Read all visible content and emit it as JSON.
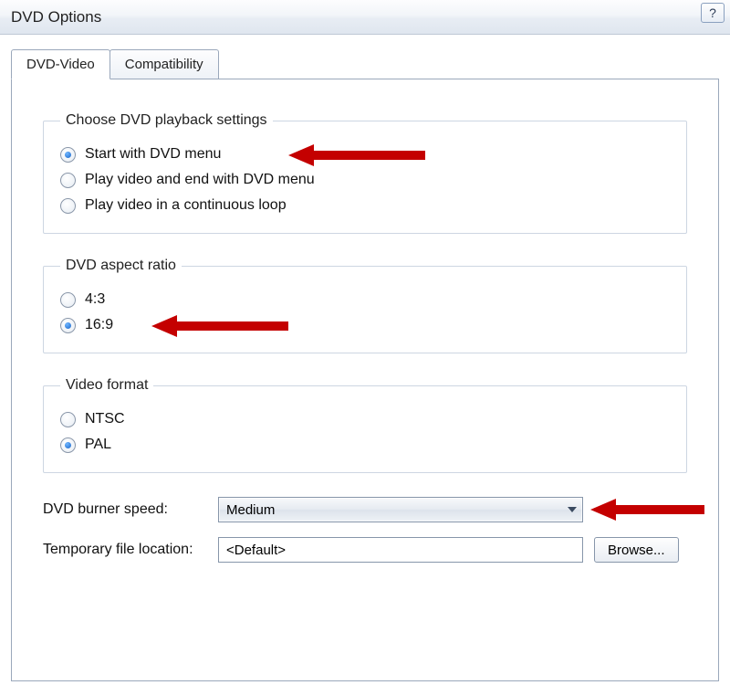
{
  "window": {
    "title": "DVD Options"
  },
  "tabs": {
    "t0": "DVD-Video",
    "t1": "Compatibility"
  },
  "playback": {
    "legend": "Choose DVD playback settings",
    "opt0": "Start with DVD menu",
    "opt1": "Play video and end with DVD menu",
    "opt2": "Play video in a continuous loop"
  },
  "aspect": {
    "legend": "DVD aspect ratio",
    "opt0": "4:3",
    "opt1": "16:9"
  },
  "format": {
    "legend": "Video format",
    "opt0": "NTSC",
    "opt1": "PAL"
  },
  "burner": {
    "label": "DVD burner speed:",
    "value": "Medium"
  },
  "temp": {
    "label": "Temporary file location:",
    "value": "<Default>",
    "browse": "Browse..."
  }
}
